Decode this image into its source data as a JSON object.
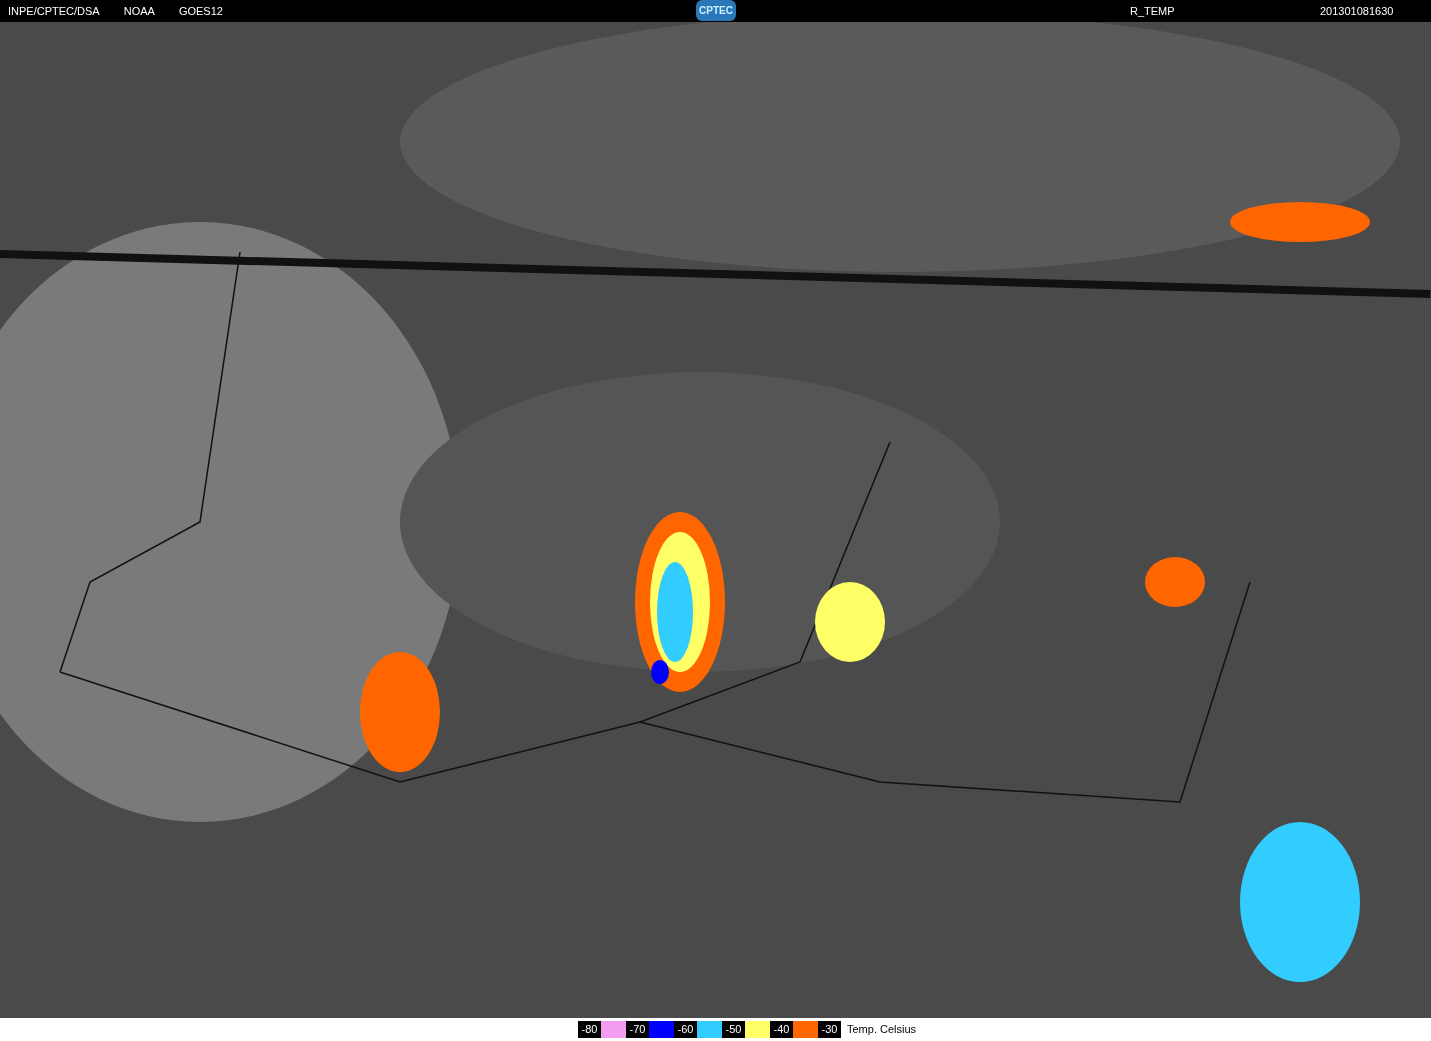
{
  "header": {
    "left": [
      "INPE/CPTEC/DSA",
      "NOAA",
      "GOES12"
    ],
    "logo": "CPTEC",
    "product": "R_TEMP",
    "timestamp": "201301081630"
  },
  "legend": {
    "items": [
      {
        "label": "-80",
        "color": "#f49cf0"
      },
      {
        "label": "-70",
        "color": "#0000ff"
      },
      {
        "label": "-60",
        "color": "#33ccff"
      },
      {
        "label": "-50",
        "color": "#ffff66"
      },
      {
        "label": "-40",
        "color": "#ff6600"
      },
      {
        "label": "-30"
      }
    ],
    "unit": "Temp. Celsius"
  }
}
